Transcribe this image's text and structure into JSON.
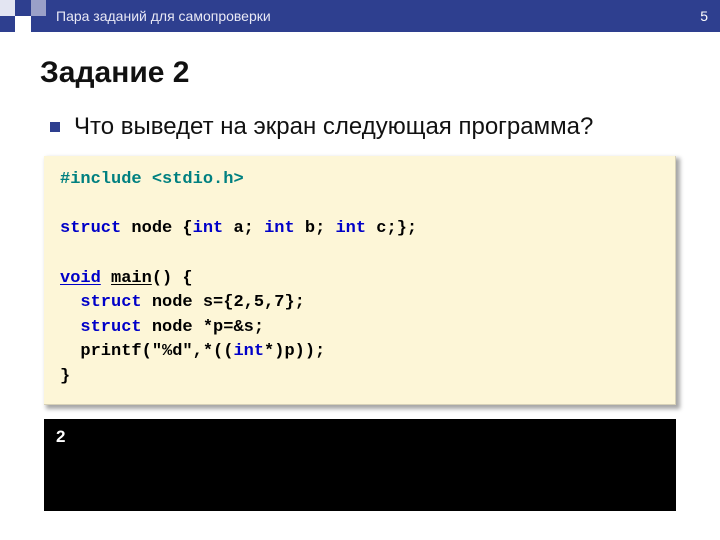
{
  "header": {
    "breadcrumb": "Пара заданий для самопроверки",
    "page_number": "5"
  },
  "title": "Задание 2",
  "question": "Что выведет на экран следующая программа?",
  "code": {
    "include_kw": "#include",
    "include_lib": "<stdio.h>",
    "struct_kw": "struct",
    "struct_decl_rest": "node {",
    "int_kw": "int",
    "field_a": "a;",
    "field_b": "b;",
    "field_c": "c;};",
    "void_kw": "void",
    "main_fn": "main",
    "main_paren": "() {",
    "node_s_decl": "node s={2,5,7};",
    "node_p_decl": "node *p=&s;",
    "printf_line": "  printf(\"%d\",*((",
    "printf_cast_int": "int",
    "printf_tail": "*)p));",
    "close_brace": "}"
  },
  "output": "2"
}
